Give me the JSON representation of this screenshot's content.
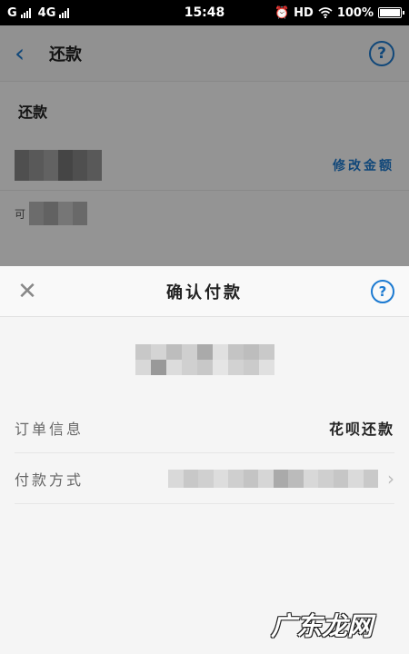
{
  "status_bar": {
    "carrier1": "G",
    "carrier2": "4G",
    "time": "15:48",
    "hd": "HD",
    "battery": "100%"
  },
  "background": {
    "title": "还款",
    "section_label": "还款",
    "modify_amount": "修改金额",
    "available_prefix": "可"
  },
  "sheet": {
    "title": "确认付款",
    "order_info_label": "订单信息",
    "order_info_value": "花呗还款",
    "payment_method_label": "付款方式"
  },
  "watermark": "广东龙网",
  "colors": {
    "accent": "#1c7ad1",
    "status_bar": "#000000"
  },
  "icons": {
    "back": "chevron-left-icon",
    "help": "question-circle-icon",
    "close": "close-icon",
    "chevron": "chevron-right-icon",
    "wifi": "wifi-icon",
    "alarm": "alarm-icon"
  }
}
